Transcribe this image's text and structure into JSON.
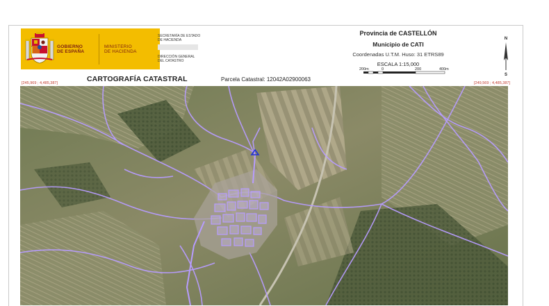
{
  "header": {
    "gobierno": [
      "GOBIERNO",
      "DE ESPAÑA"
    ],
    "ministerio": [
      "MINISTERIO",
      "DE HACIENDA"
    ],
    "secretaria": [
      "SECRETARÍA DE ESTADO",
      "DE HACIENDA"
    ],
    "direccion": [
      "DIRECCIÓN GENERAL",
      "DEL CATASTRO"
    ],
    "provincia": "Provincia de CASTELLÓN",
    "municipio": "Municipio de CATI",
    "coordenadas": "Coordenadas U.T.M. Huso: 31 ETRS89",
    "escala": "ESCALA 1:15,000",
    "scale_ticks": [
      "200m",
      "0",
      "200",
      "400m"
    ],
    "north": "N",
    "south": "S"
  },
  "map_titles": {
    "cartografia": "CARTOGRAFÍA CATASTRAL",
    "parcela_label": "Parcela Catastral:",
    "parcela_ref": "12042A02900063",
    "coord_top_left": "[245,969 ; 4,485,387]",
    "coord_top_right": "[249,569 ; 4,485,387]"
  },
  "colors": {
    "brand_yellow": "#f3bd00",
    "brand_red": "#7a1d12",
    "coord_red": "#c0392b",
    "parcel_lines": "#b79cff",
    "parcel_marker": "#1c2fd8"
  }
}
